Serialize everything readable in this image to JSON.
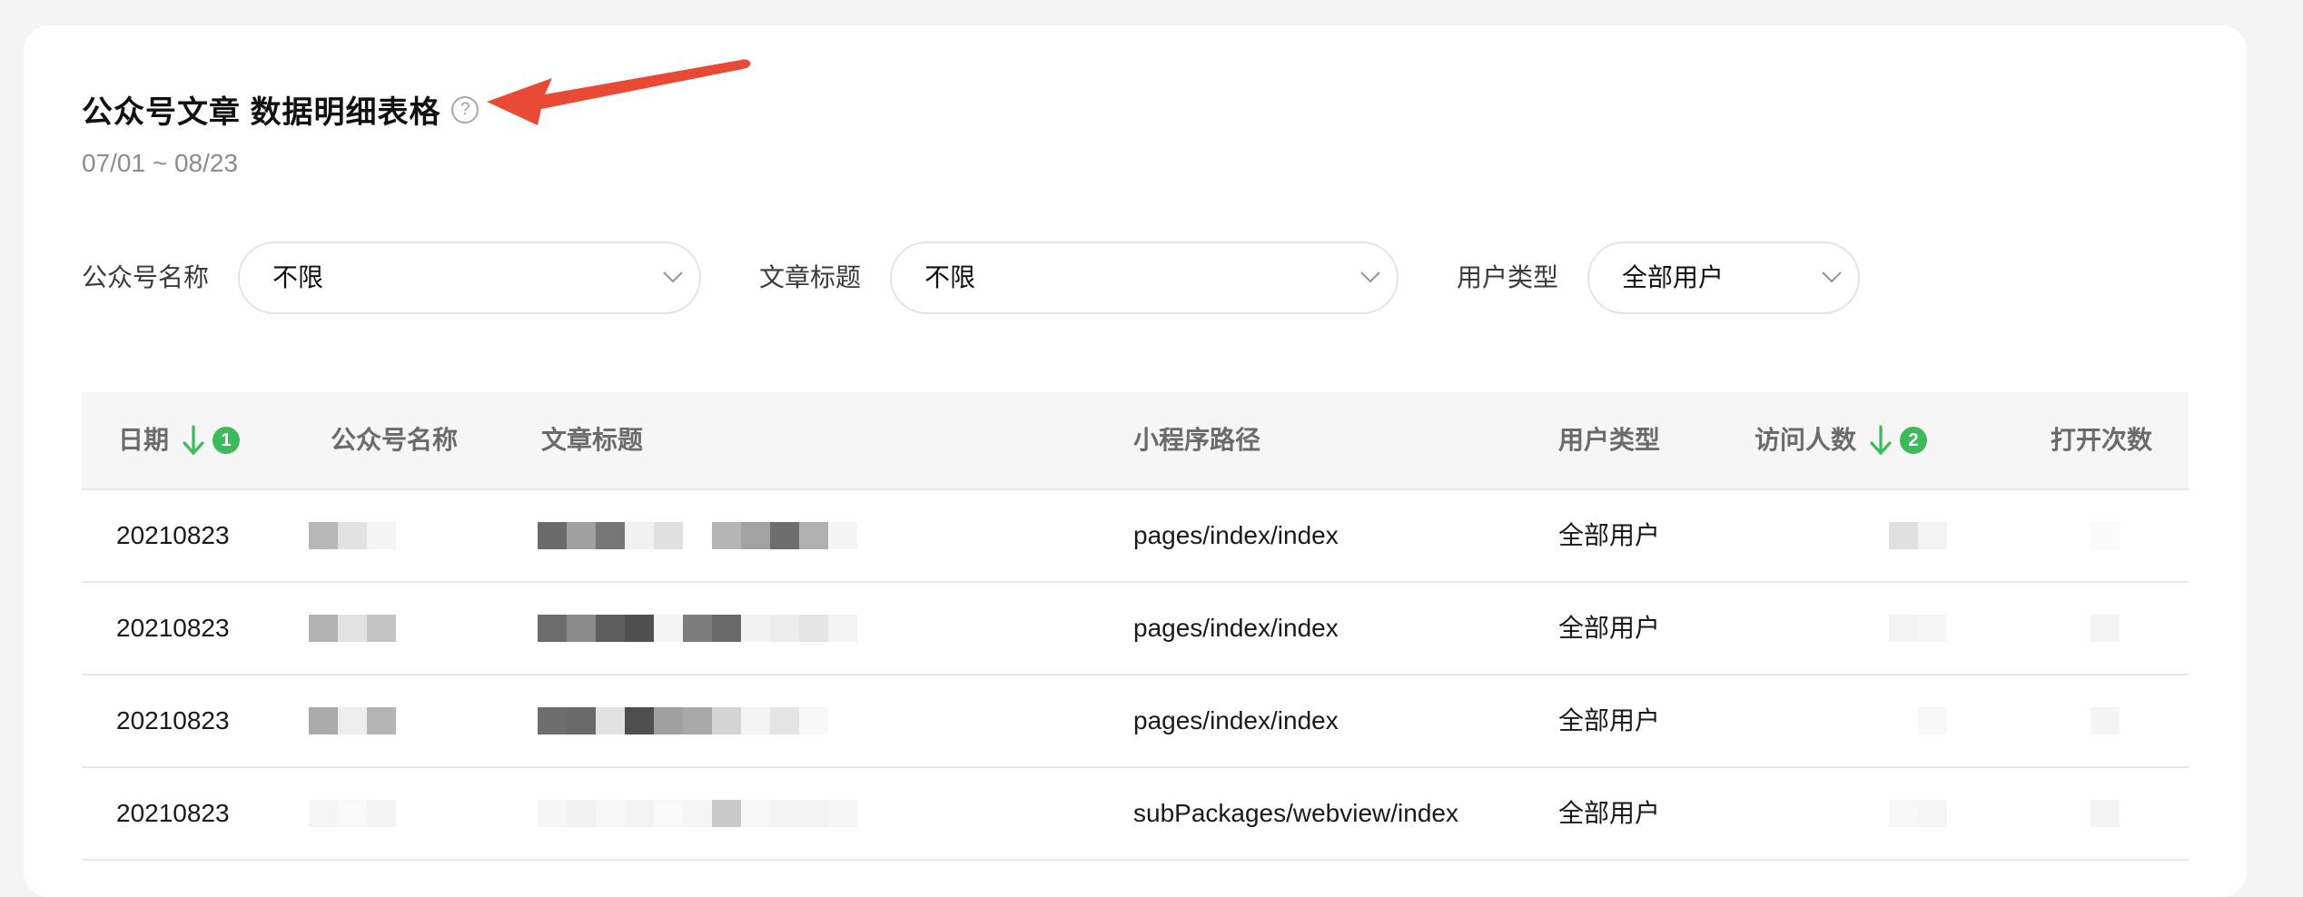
{
  "header": {
    "title": "公众号文章 数据明细表格",
    "help_icon": "question-circle-icon",
    "date_range": "07/01 ~ 08/23"
  },
  "annotation": {
    "icon": "red-arrow-icon",
    "color": "#e84a35"
  },
  "filters": [
    {
      "label": "公众号名称",
      "value": "不限"
    },
    {
      "label": "文章标题",
      "value": "不限"
    },
    {
      "label": "用户类型",
      "value": "全部用户"
    }
  ],
  "table": {
    "columns": [
      {
        "label": "日期",
        "sort_icon": "arrow-down-icon",
        "badge": "1"
      },
      {
        "label": "公众号名称"
      },
      {
        "label": "文章标题"
      },
      {
        "label": "小程序路径"
      },
      {
        "label": "用户类型"
      },
      {
        "label": "访问人数",
        "sort_icon": "arrow-down-icon",
        "badge": "2"
      },
      {
        "label": "打开次数"
      }
    ],
    "rows": [
      {
        "date": "20210823",
        "path": "pages/index/index",
        "user_type": "全部用户"
      },
      {
        "date": "20210823",
        "path": "pages/index/index",
        "user_type": "全部用户"
      },
      {
        "date": "20210823",
        "path": "pages/index/index",
        "user_type": "全部用户"
      },
      {
        "date": "20210823",
        "path": "subPackages/webview/index",
        "user_type": "全部用户"
      }
    ]
  },
  "colors": {
    "accent_green": "#3dba5b",
    "card_bg": "#ffffff",
    "page_bg": "#f4f4f4"
  }
}
